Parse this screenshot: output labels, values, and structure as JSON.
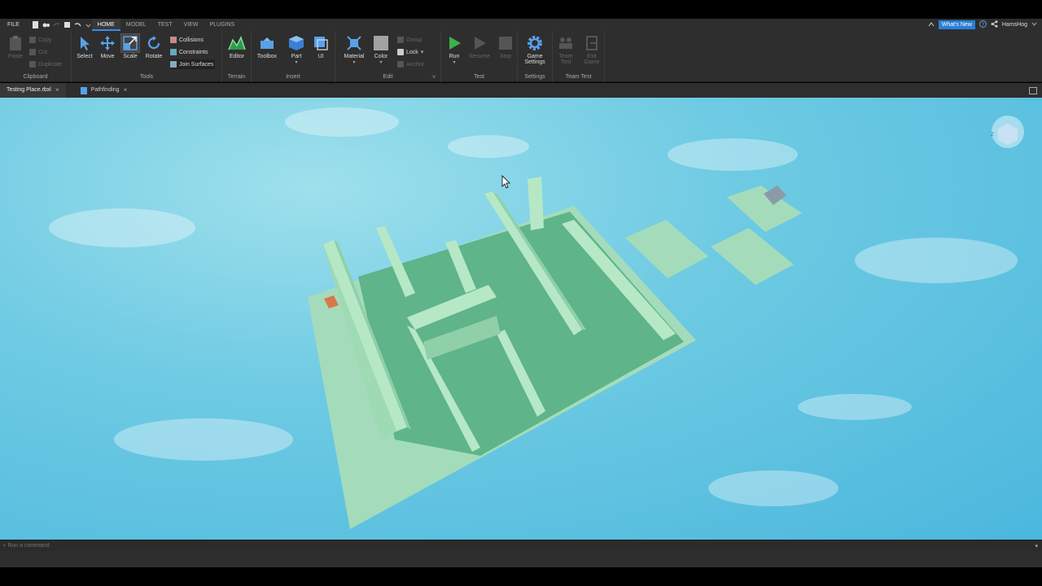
{
  "menubar": {
    "file": "FILE",
    "tabs": [
      "HOME",
      "MODEL",
      "TEST",
      "VIEW",
      "PLUGINS"
    ],
    "active_tab": "HOME",
    "whats_new": "What's New",
    "username": "HamsHog"
  },
  "ribbon": {
    "clipboard": {
      "label": "Clipboard",
      "paste": "Paste",
      "copy": "Copy",
      "cut": "Cut",
      "duplicate": "Duplicate"
    },
    "tools": {
      "label": "Tools",
      "select": "Select",
      "move": "Move",
      "scale": "Scale",
      "rotate": "Rotate",
      "collisions": "Collisions",
      "constraints": "Constraints",
      "join_surfaces": "Join Surfaces"
    },
    "terrain": {
      "label": "Terrain",
      "editor": "Editor"
    },
    "insert": {
      "label": "Insert",
      "toolbox": "Toolbox",
      "part": "Part",
      "ui": "UI"
    },
    "edit": {
      "label": "Edit",
      "material": "Material",
      "color": "Color",
      "group": "Group",
      "lock": "Lock",
      "anchor": "Anchor"
    },
    "test": {
      "label": "Test",
      "run": "Run",
      "resume": "Resume",
      "stop": "Stop"
    },
    "settings": {
      "label": "Settings",
      "game_settings_1": "Game",
      "game_settings_2": "Settings"
    },
    "team_test": {
      "label": "Team Test",
      "team_test_1": "Team",
      "team_test_2": "Test",
      "exit_game_1": "Exit",
      "exit_game_2": "Game"
    }
  },
  "doc_tabs": [
    {
      "label": "Testing Place.rbxl"
    },
    {
      "label": "Pathfinding"
    }
  ],
  "command_bar": {
    "placeholder": "Run a command"
  },
  "colors": {
    "accent": "#3a8cf0",
    "whats_new": "#2a7fd6",
    "run_green": "#3bb14a",
    "maze_light": "#a8e0bc",
    "maze_dark": "#5fb58a",
    "sky": "#6fcbe3"
  }
}
